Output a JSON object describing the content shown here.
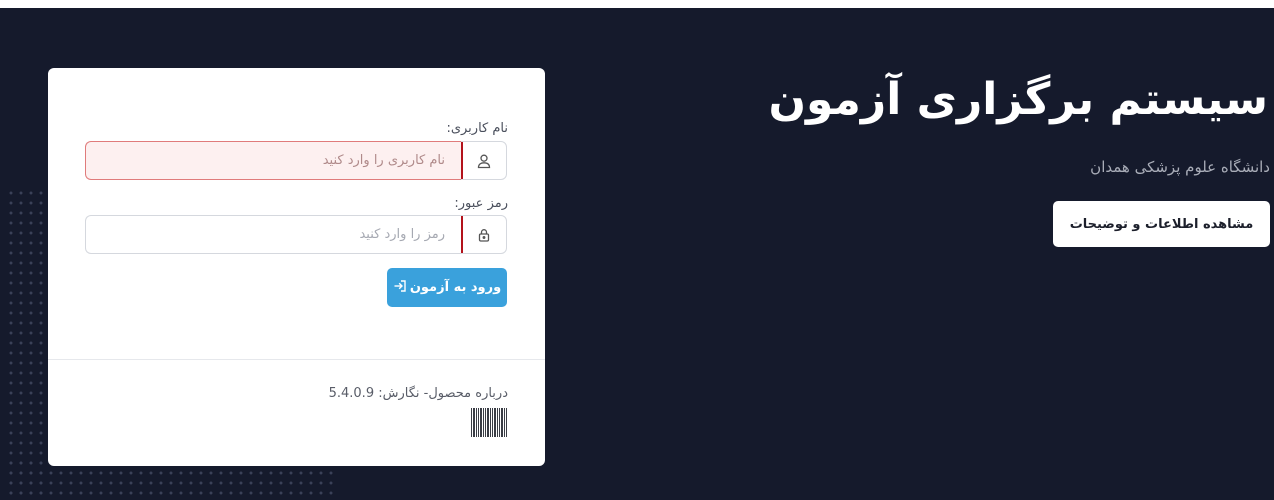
{
  "hero": {
    "title": "سیستم برگزاری آزمون",
    "subtitle": "دانشگاه علوم پزشکی همدان",
    "info_button": "مشاهده اطلاعات و توضیحات"
  },
  "login": {
    "username_label": "نام کاربری:",
    "username_placeholder": "نام کاربری را وارد کنید",
    "password_label": "رمز عبور:",
    "password_placeholder": "رمز را وارد کنید",
    "submit_label": "ورود به آزمون",
    "about_text": "درباره محصول- نگارش: 5.4.0.9"
  },
  "icons": {
    "username": "user-icon",
    "password": "lock-icon",
    "submit": "sign-in-icon",
    "barcode": "barcode-icon"
  },
  "colors": {
    "background": "#151a2c",
    "primary_button": "#3aa1dc",
    "error_accent": "#b3121b",
    "error_field_bg": "#fdf0f0"
  }
}
